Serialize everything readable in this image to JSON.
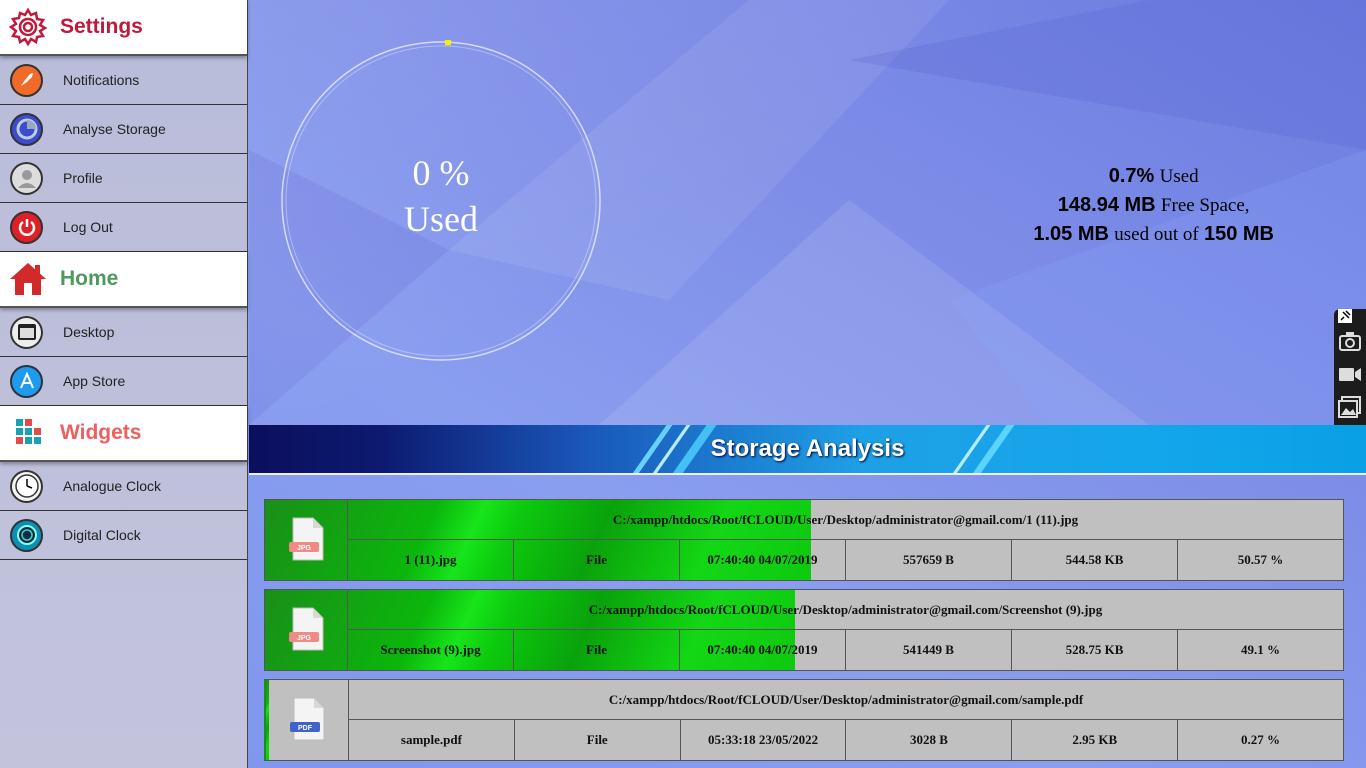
{
  "sidebar": {
    "settings": {
      "title": "Settings",
      "color": "#c0193b",
      "items": [
        {
          "label": "Notifications",
          "icon": "rocket-icon"
        },
        {
          "label": "Analyse Storage",
          "icon": "storage-chart-icon"
        },
        {
          "label": "Profile",
          "icon": "user-icon"
        },
        {
          "label": "Log Out",
          "icon": "power-icon"
        }
      ]
    },
    "home": {
      "title": "Home",
      "color": "#4e9a5c",
      "items": [
        {
          "label": "Desktop",
          "icon": "desktop-icon"
        },
        {
          "label": "App Store",
          "icon": "app-store-icon"
        }
      ]
    },
    "widgets": {
      "title": "Widgets",
      "color": "#ef5f5f",
      "items": [
        {
          "label": "Analogue Clock",
          "icon": "analogue-clock-icon"
        },
        {
          "label": "Digital Clock",
          "icon": "digital-clock-icon"
        }
      ]
    }
  },
  "gauge": {
    "percent_label": "0 %",
    "used_label": "Used",
    "fraction": 0.007
  },
  "usage": {
    "used_percent": "0.7%",
    "used_word": "Used",
    "free": "148.94 MB",
    "free_word": "Free Space,",
    "used_amount": "1.05 MB",
    "used_out_of": "used out of",
    "total": "150 MB"
  },
  "banner": {
    "title": "Storage Analysis"
  },
  "files": [
    {
      "path": "C:/xampp/htdocs/Root/fCLOUD/User/Desktop/administrator@gmail.com/1 (11).jpg",
      "name": "1 (11).jpg",
      "type": "File",
      "modified": "07:40:40 04/07/2019",
      "bytes": "557659 B",
      "size": "544.58 KB",
      "percent": "50.57 %",
      "share": 0.5057,
      "icon": "jpg-file-icon",
      "ext": "JPG"
    },
    {
      "path": "C:/xampp/htdocs/Root/fCLOUD/User/Desktop/administrator@gmail.com/Screenshot (9).jpg",
      "name": "Screenshot (9).jpg",
      "type": "File",
      "modified": "07:40:40 04/07/2019",
      "bytes": "541449 B",
      "size": "528.75 KB",
      "percent": "49.1 %",
      "share": 0.491,
      "icon": "jpg-file-icon",
      "ext": "JPG"
    },
    {
      "path": "C:/xampp/htdocs/Root/fCLOUD/User/Desktop/administrator@gmail.com/sample.pdf",
      "name": "sample.pdf",
      "type": "File",
      "modified": "05:33:18 23/05/2022",
      "bytes": "3028 B",
      "size": "2.95 KB",
      "percent": "0.27 %",
      "share": 0.0027,
      "icon": "pdf-file-icon",
      "ext": "PDF"
    }
  ],
  "toolbar": {
    "icons": [
      "pin-icon",
      "camera-icon",
      "video-icon",
      "gallery-icon",
      "settings-gear-icon"
    ]
  }
}
